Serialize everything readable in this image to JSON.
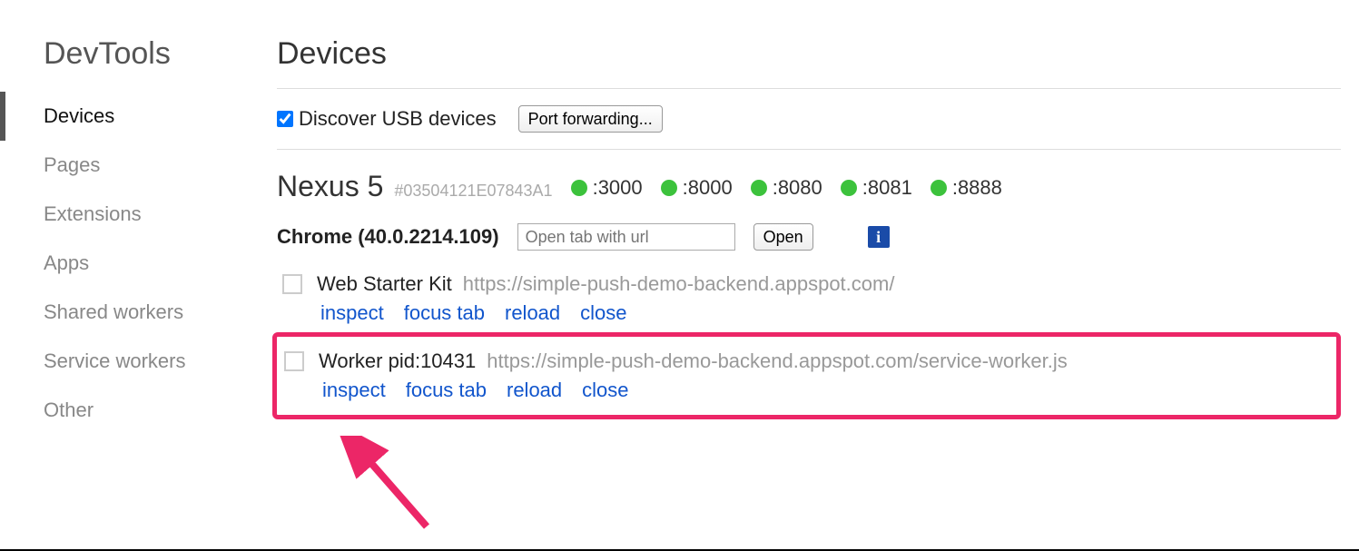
{
  "sidebar": {
    "title": "DevTools",
    "items": [
      {
        "label": "Devices",
        "active": true
      },
      {
        "label": "Pages"
      },
      {
        "label": "Extensions"
      },
      {
        "label": "Apps"
      },
      {
        "label": "Shared workers"
      },
      {
        "label": "Service workers"
      },
      {
        "label": "Other"
      }
    ]
  },
  "main": {
    "title": "Devices",
    "discover_label": "Discover USB devices",
    "discover_checked": true,
    "port_forwarding_btn": "Port forwarding...",
    "device": {
      "name": "Nexus 5",
      "id": "#03504121E07843A1",
      "ports": [
        ":3000",
        ":8000",
        ":8080",
        ":8081",
        ":8888"
      ]
    },
    "browser": {
      "name": "Chrome (40.0.2214.109)",
      "open_placeholder": "Open tab with url",
      "open_btn": "Open"
    },
    "tabs": [
      {
        "title": "Web Starter Kit",
        "url": "https://simple-push-demo-backend.appspot.com/",
        "actions": [
          "inspect",
          "focus tab",
          "reload",
          "close"
        ],
        "highlight": false
      },
      {
        "title": "Worker pid:10431",
        "url": "https://simple-push-demo-backend.appspot.com/service-worker.js",
        "actions": [
          "inspect",
          "focus tab",
          "reload",
          "close"
        ],
        "highlight": true
      }
    ]
  }
}
